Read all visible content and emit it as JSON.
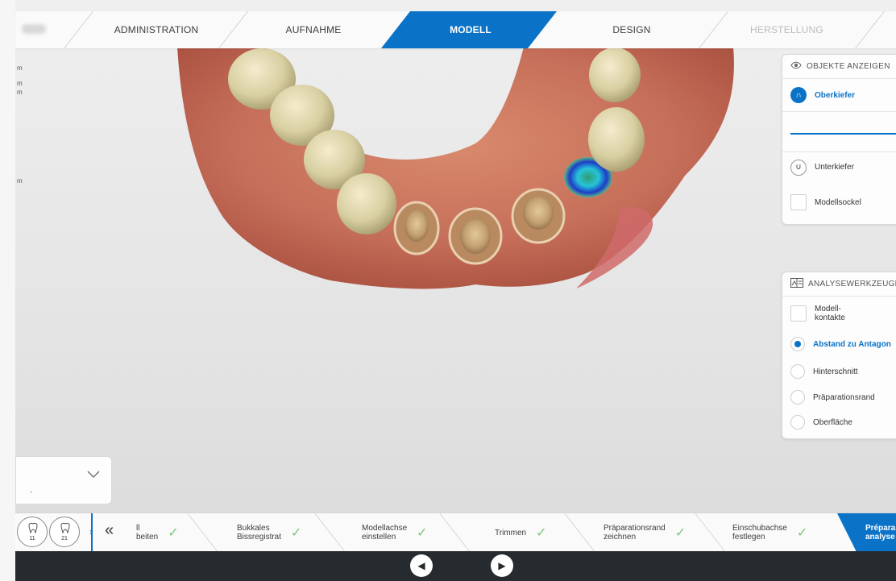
{
  "top_nav": {
    "tabs": [
      {
        "label": "ADMINISTRATION",
        "state": "done"
      },
      {
        "label": "AUFNAHME",
        "state": "done"
      },
      {
        "label": "MODELL",
        "state": "active"
      },
      {
        "label": "DESIGN",
        "state": "todo"
      },
      {
        "label": "HERSTELLUNG",
        "state": "disabled"
      }
    ]
  },
  "left_labels": [
    "m",
    "m",
    "m",
    "m"
  ],
  "objects_panel": {
    "title": "OBJEKTE ANZEIGEN",
    "upper_jaw": "Oberkiefer",
    "lower_jaw": "Unterkiefer",
    "model_base": "Modellsockel"
  },
  "analysis_panel": {
    "title": "ANALYSEWERKZEUGE",
    "contacts": "Modell-\nkontakte",
    "options": [
      {
        "label": "Abstand zu Antagon",
        "selected": true
      },
      {
        "label": "Hinterschnitt",
        "selected": false
      },
      {
        "label": "Präparationsrand",
        "selected": false
      },
      {
        "label": "Oberfläche",
        "selected": false
      }
    ]
  },
  "selector_box": {
    "value": "-"
  },
  "teeth": [
    {
      "number": "11"
    },
    {
      "number": "21"
    }
  ],
  "workflow": {
    "steps": [
      {
        "label": "ll\nbeiten",
        "done": true
      },
      {
        "label": "Bukkales\nBissregistrat",
        "done": true
      },
      {
        "label": "Modellachse\neinstellen",
        "done": true
      },
      {
        "label": "Trimmen",
        "done": true
      },
      {
        "label": "Präparationsrand\nzeichnen",
        "done": true
      },
      {
        "label": "Einschubachse\nfestlegen",
        "done": true
      }
    ],
    "active": "Prépara\nanalyse"
  },
  "colors": {
    "accent": "#0a73c7",
    "check": "#78c878",
    "footer": "#262b30"
  },
  "icons": {
    "collapse": "«",
    "prev": "◀",
    "next": "▶",
    "check": "✓"
  }
}
